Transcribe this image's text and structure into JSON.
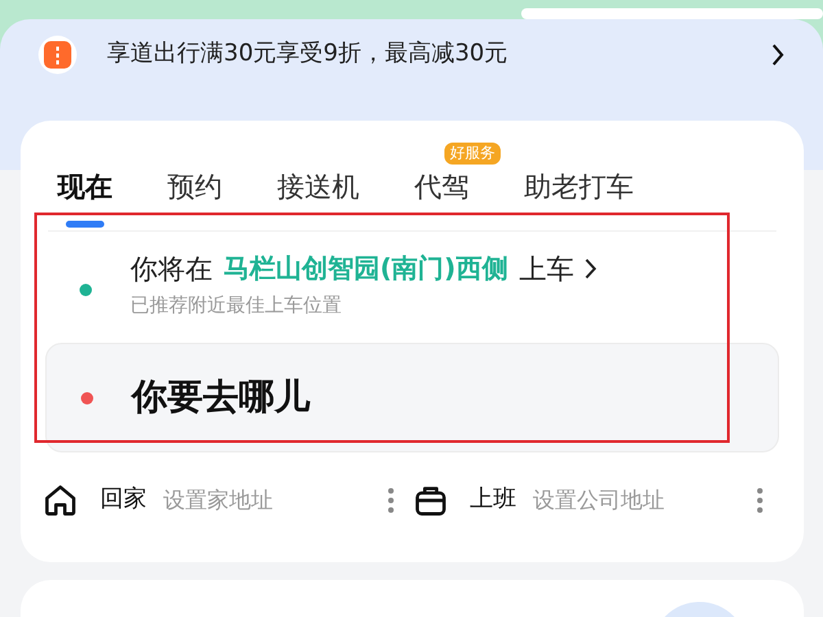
{
  "promo": {
    "text": "享道出行满30元享受9折，最高减30元"
  },
  "tabs": [
    {
      "label": "现在",
      "selected": true
    },
    {
      "label": "预约",
      "selected": false
    },
    {
      "label": "接送机",
      "selected": false
    },
    {
      "label": "代驾",
      "selected": false,
      "badge": "好服务"
    },
    {
      "label": "助老打车",
      "selected": false
    }
  ],
  "pickup": {
    "prefix": "你将在",
    "place": "马栏山创智园(南门)西侧",
    "suffix": "上车",
    "hint": "已推荐附近最佳上车位置",
    "color": "#1fb394"
  },
  "destination": {
    "placeholder": "你要去哪儿",
    "color": "#f05454"
  },
  "shortcuts": [
    {
      "kind": "home",
      "label": "回家",
      "hint": "设置家地址"
    },
    {
      "kind": "work",
      "label": "上班",
      "hint": "设置公司地址"
    }
  ]
}
